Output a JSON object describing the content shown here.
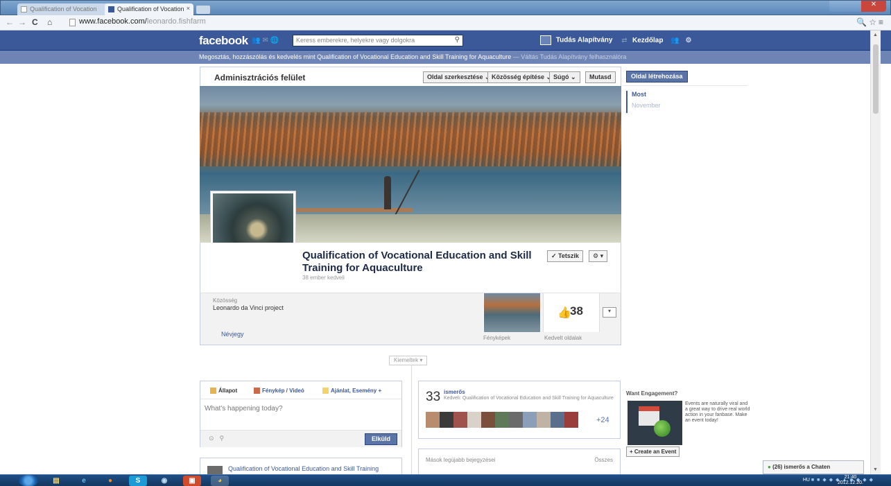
{
  "browser": {
    "tabs": [
      {
        "label": "Qualification of Vocation"
      },
      {
        "label": "Qualification of Vocation"
      }
    ],
    "url_domain": "www.facebook.com/",
    "url_path": "leonardo.fishfarm"
  },
  "fb": {
    "logo": "facebook",
    "search_placeholder": "Keress emberekre, helyekre vagy dolgokra",
    "user_name": "Tudás Alapítvány",
    "home_label": "Kezdőlap",
    "notice": "Megosztás, hozzászólás és kedvelés mint Qualification of Vocational Education and Skill Training for Aquaculture",
    "notice_switch": " — Váltás Tudás Alapítvány felhasználóra"
  },
  "admin": {
    "title": "Adminisztrációs felület",
    "buttons": [
      "Oldal szerkesztése ⌄",
      "Közösség építése ⌄",
      "Súgó ⌄",
      "Mutasd"
    ],
    "create_page": "Oldal létrehozása"
  },
  "timeline_nav": [
    "Most",
    "November"
  ],
  "page": {
    "name": "Qualification of Vocational Education and Skill Training for Aquaculture",
    "likes_sub": "38 ember kedveli",
    "like_button": "✓ Tetszik",
    "gear_button": "⚙ ▾",
    "category_label": "Közösség",
    "category_value": "Leonardo da Vinci project",
    "card_link": "Névjegy",
    "photos_label": "Fényképek",
    "likes_label": "Kedvelt oldalak",
    "likes_count": "38",
    "highlights": "Kiemeltek ▾"
  },
  "composer": {
    "tabs": [
      "Állapot",
      "Fénykép / Videó",
      "Ajánlat, Esemény +"
    ],
    "placeholder": "What's happening today?",
    "post_button": "Elküld"
  },
  "friends": {
    "count": "33",
    "title": "ismerős",
    "subtitle": "Kedveli: Qualification of Vocational Education and Skill Training for Aquaculture",
    "more": "+24"
  },
  "recent": {
    "post_title": "Qualification of Vocational Education and Skill Training",
    "others_label": "Mások legújabb bejegyzései",
    "all_label": "Összes"
  },
  "sponsor": {
    "heading": "Want Engagement?",
    "body": "Events are naturally viral and a great way to drive real world action in your fanbase. Make an event today!",
    "button": "+ Create an Event"
  },
  "chat": {
    "label": "(26) ismerős a Chaten"
  },
  "taskbar": {
    "lang": "HU",
    "time": "21:40",
    "date": "2012.12.20."
  },
  "colors": {
    "fb_blue": "#3b5998",
    "fb_header_sub": "#6d84b4",
    "taskbar": "#1f4f86"
  }
}
